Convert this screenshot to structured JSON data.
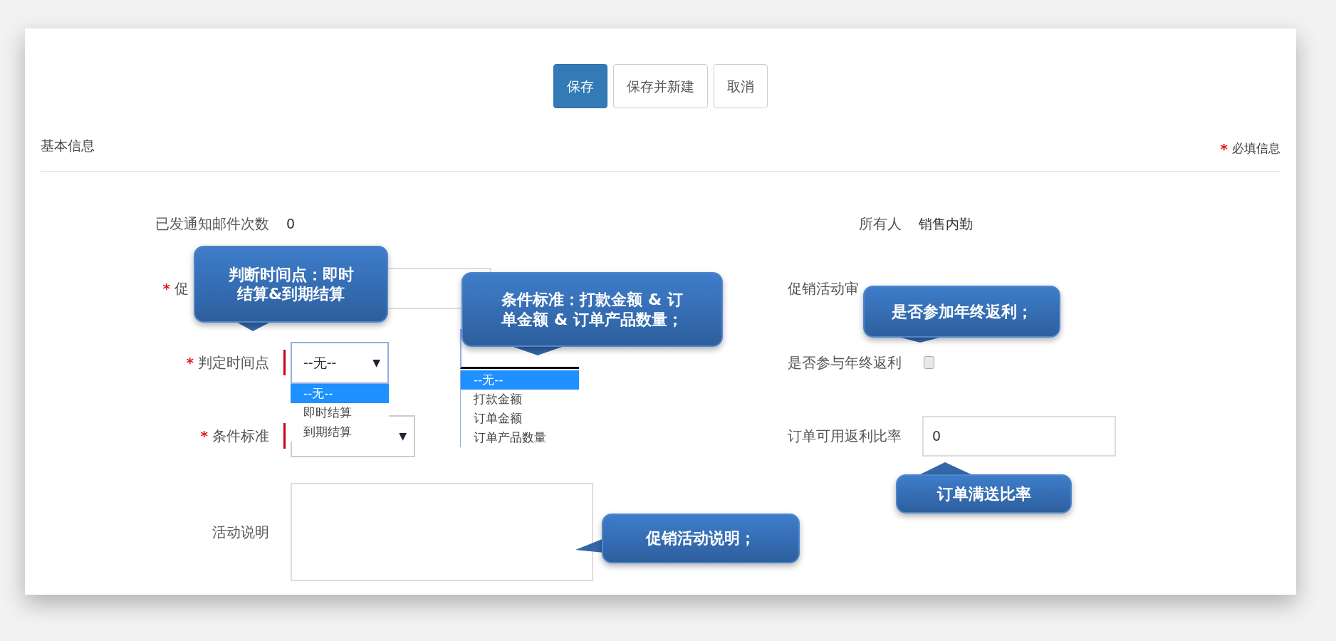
{
  "buttons": [
    {
      "label": "保存",
      "kind": "primary"
    },
    {
      "label": "保存并新建",
      "kind": "default"
    },
    {
      "label": "取消",
      "kind": "default"
    }
  ],
  "section": {
    "title": "基本信息",
    "required_mark": "*",
    "required_note": "必填信息"
  },
  "rows": [
    {
      "left": {
        "kind": "text",
        "label": "已发通知邮件次数",
        "value": "0",
        "required": false
      },
      "right": {
        "kind": "text",
        "label": "所有人",
        "value": "销售内勤"
      }
    },
    {
      "left": {
        "kind": "input",
        "label": "促",
        "required": true
      },
      "right": {
        "kind": "label",
        "label": "促销活动审"
      }
    },
    {
      "left": {
        "kind": "select",
        "label": "判定时间点",
        "required": true,
        "value": "--无--",
        "caret": "▼",
        "options": [
          {
            "label": "--无--",
            "selected": true
          },
          {
            "label": "即时结算",
            "selected": false
          },
          {
            "label": "到期结算",
            "selected": false
          }
        ]
      },
      "middle": {
        "kind": "select",
        "options": [
          {
            "label": "--无--",
            "selected": true
          },
          {
            "label": "打款金额",
            "selected": false
          },
          {
            "label": "订单金额",
            "selected": false
          },
          {
            "label": "订单产品数量",
            "selected": false
          }
        ]
      },
      "right": {
        "kind": "checkbox",
        "label": "是否参与年终返利",
        "checked": false
      }
    },
    {
      "left": {
        "kind": "select",
        "label": "条件标准",
        "required": true,
        "caret": "▼"
      },
      "right": {
        "kind": "input",
        "label": "订单可用返利比率",
        "value": "0"
      }
    },
    {
      "left": {
        "kind": "textarea",
        "label": "活动说明",
        "required": false
      }
    }
  ],
  "callouts": [
    {
      "lines": [
        "判断时间点：即时",
        "结算&到期结算"
      ]
    },
    {
      "lines": [
        "条件标准：打款金额 & 订",
        "单金额 & 订单产品数量；"
      ]
    },
    {
      "lines": [
        "是否参加年终返利；"
      ]
    },
    {
      "lines": [
        "订单满送比率"
      ]
    },
    {
      "lines": [
        "促销活动说明；"
      ]
    }
  ]
}
